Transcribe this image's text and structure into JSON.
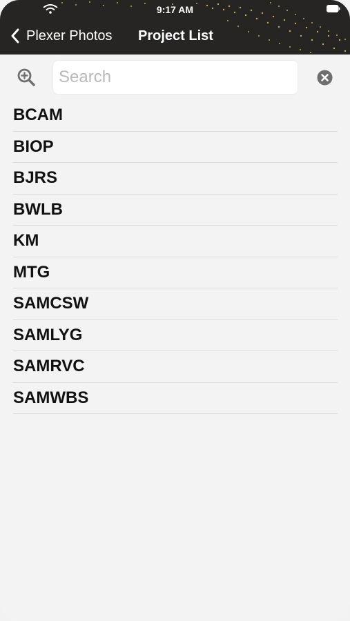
{
  "status_bar": {
    "time": "9:17 AM"
  },
  "nav": {
    "back_label": "Plexer Photos",
    "title": "Project List"
  },
  "search": {
    "placeholder": "Search",
    "value": ""
  },
  "projects": [
    "BCAM",
    "BIOP",
    "BJRS",
    "BWLB",
    "KM",
    "MTG",
    "SAMCSW",
    "SAMLYG",
    "SAMRVC",
    "SAMWBS"
  ],
  "colors": {
    "header_bg": "#262524",
    "accent_gold": "#c9a64a",
    "icon_gray": "#6e6e6e"
  }
}
